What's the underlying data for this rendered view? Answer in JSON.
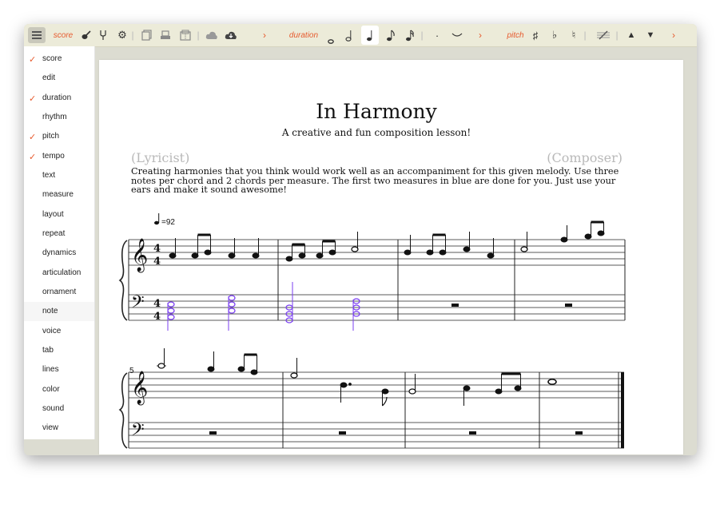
{
  "toolbar": {
    "score_label": "score",
    "duration_label": "duration",
    "pitch_label": "pitch",
    "chevron": "›",
    "separator": "|",
    "icons": {
      "menu": "hamburger-menu-icon",
      "guitar": "guitar-icon",
      "tuning_fork": "tuning-fork-icon",
      "settings": "gear-icon",
      "copy": "copy-pages-icon",
      "print": "print-icon",
      "zip": "zip-archive-icon",
      "cloud_upload": "cloud-upload-icon",
      "cloud_download": "cloud-download-icon",
      "whole_note": "whole-note-icon",
      "half_note": "half-note-icon",
      "quarter_note": "quarter-note-icon",
      "eighth_note": "eighth-note-icon",
      "sixteenth_note": "sixteenth-note-icon",
      "dot": "dot-icon",
      "tie": "tie-icon",
      "sharp": "sharp-icon",
      "flat": "flat-icon",
      "natural": "natural-icon",
      "staff_edit": "staff-edit-icon",
      "up": "arrow-up-icon",
      "down": "arrow-down-icon"
    },
    "glyphs": {
      "whole_note": "𝅝",
      "half_note": "𝅗𝅥",
      "quarter_note": "♩",
      "eighth_note": "♪",
      "sixteenth_note": "𝅘𝅥𝅯",
      "dot": "·",
      "tie": "‿",
      "sharp": "♯",
      "flat": "♭",
      "natural": "♮",
      "up": "▲",
      "down": "▼",
      "gear": "⚙"
    },
    "accent_color": "#e65a2e"
  },
  "sidebar": {
    "check_glyph": "✓",
    "items": [
      {
        "label": "score",
        "checked": true
      },
      {
        "label": "edit",
        "checked": false
      },
      {
        "label": "duration",
        "checked": true
      },
      {
        "label": "rhythm",
        "checked": false
      },
      {
        "label": "pitch",
        "checked": true
      },
      {
        "label": "tempo",
        "checked": true
      },
      {
        "label": "text",
        "checked": false
      },
      {
        "label": "measure",
        "checked": false
      },
      {
        "label": "layout",
        "checked": false
      },
      {
        "label": "repeat",
        "checked": false
      },
      {
        "label": "dynamics",
        "checked": false
      },
      {
        "label": "articulation",
        "checked": false
      },
      {
        "label": "ornament",
        "checked": false
      },
      {
        "label": "note",
        "checked": false
      },
      {
        "label": "voice",
        "checked": false
      },
      {
        "label": "tab",
        "checked": false
      },
      {
        "label": "lines",
        "checked": false
      },
      {
        "label": "color",
        "checked": false
      },
      {
        "label": "sound",
        "checked": false
      },
      {
        "label": "view",
        "checked": false
      }
    ]
  },
  "sheet": {
    "title": "In Harmony",
    "subtitle": "A creative and fun composition lesson!",
    "lyricist": "(Lyricist)",
    "composer": "(Composer)",
    "instructions": "Creating harmonies that you think would work well as an accompaniment for this given melody. Use three notes per chord and 2 chords per measure. The first two measures in blue are done for you. Just use your ears and make it sound awesome!",
    "tempo": "=92",
    "time_signature": "4",
    "measure_number_system2": "5",
    "highlight_color": "#7b3ff2"
  }
}
